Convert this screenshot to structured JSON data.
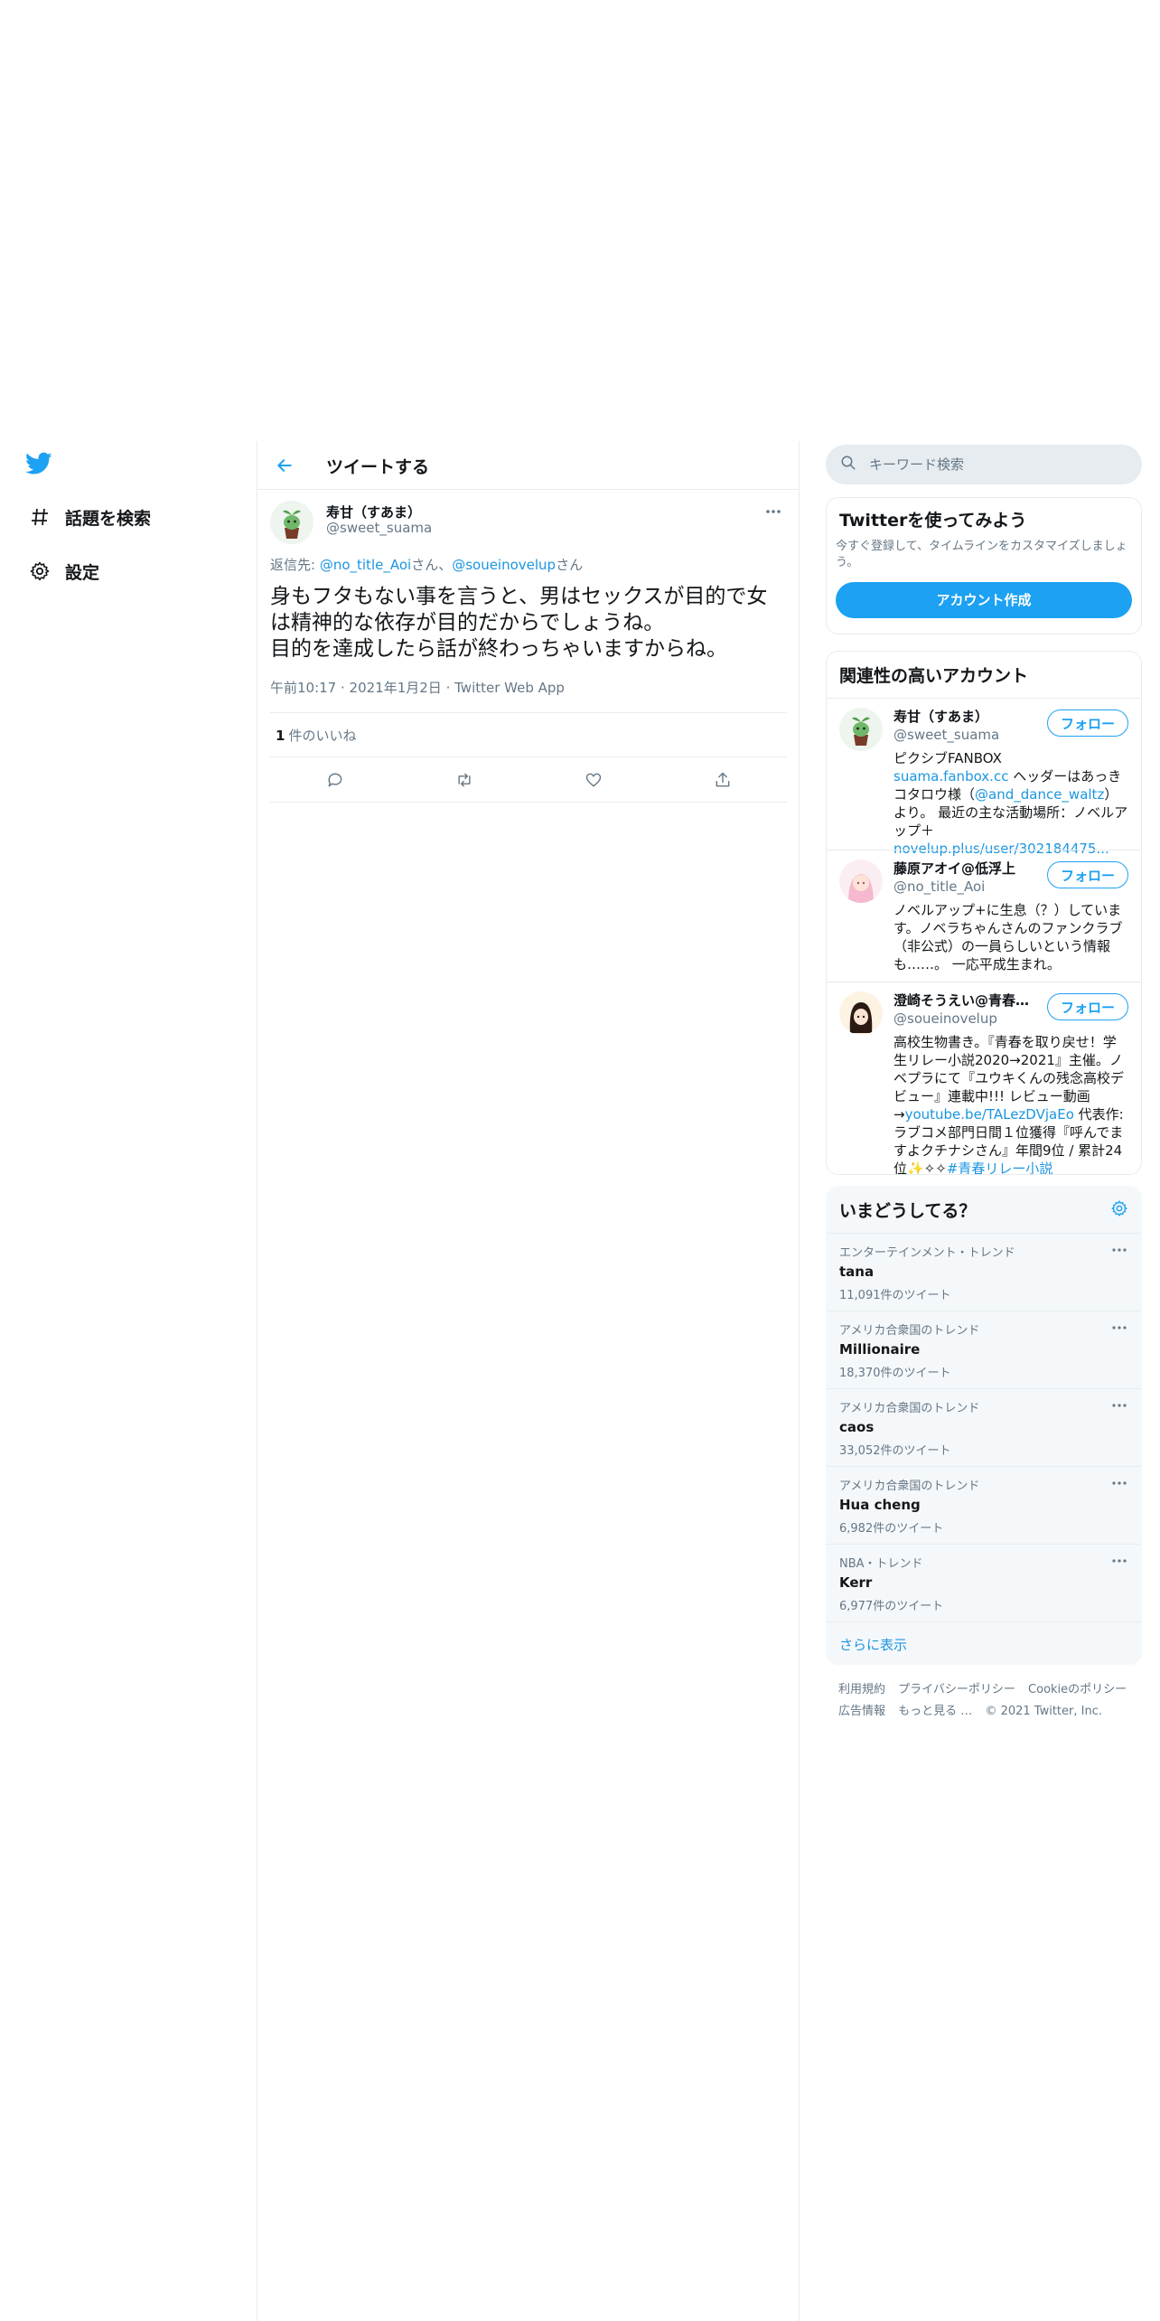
{
  "nav": {
    "logo_icon": "twitter-bird-icon",
    "items": [
      {
        "label": "話題を検索",
        "icon": "hashtag-icon"
      },
      {
        "label": "設定",
        "icon": "gear-icon"
      }
    ]
  },
  "header": {
    "title": "ツイートする"
  },
  "tweet": {
    "name": "寿甘（すあま）",
    "handle": "@sweet_suama",
    "reply_prefix": "返信先: ",
    "reply_user1": "@no_title_Aoi",
    "reply_sep": "さん、",
    "reply_user2": "@soueinovelup",
    "reply_suffix": "さん",
    "text": "身もフタもない事を言うと、男はセックスが目的で女は精神的な依存が目的だからでしょうね。\n目的を達成したら話が終わっちゃいますからね。",
    "time": "午前10:17",
    "date": "2021年1月2日",
    "source": "Twitter Web App",
    "likes_count": "1",
    "likes_label": "件のいいね"
  },
  "search": {
    "placeholder": "キーワード検索"
  },
  "signup": {
    "title": "Twitterを使ってみよう",
    "desc": "今すぐ登録して、タイムラインをカスタマイズしましょう。",
    "button": "アカウント作成"
  },
  "accounts": {
    "title": "関連性の高いアカウント",
    "follow_label": "フォロー",
    "items": [
      {
        "name": "寿甘（すあま）",
        "handle": "@sweet_suama",
        "bio_1": "ピクシブFANBOX　",
        "link_1": "suama.fanbox.cc",
        "bio_2": " ヘッダーはあっきコタロウ様（",
        "link_2": "@and_dance_waltz",
        "bio_3": "）より。 最近の主な活動場所：ノベルアップ＋　",
        "link_3": "novelup.plus/user/302184475..."
      },
      {
        "name": "藤原アオイ@低浮上",
        "handle": "@no_title_Aoi",
        "bio": "ノベルアップ+に生息（？）しています。ノベラちゃんさんのファンクラブ（非公式）の一員らしいという情報も……。 一応平成生まれ。"
      },
      {
        "name": "澄崎そうえい@青春…",
        "handle": "@soueinovelup",
        "bio_1": "高校生物書き。『青春を取り戻せ！学生リレー小説2020→2021』主催。ノベプラにて『ユウキくんの残念高校デビュー』連載中!!! レビュー動画→",
        "link_1": "youtube.be/TALezDVjaEo",
        "bio_2": " 代表作:ラブコメ部門日間１位獲得『呼んでますよクチナシさん』年間9位 / 累計24位✨✧✧",
        "link_2": "#青春リレー小説"
      }
    ]
  },
  "trends": {
    "title": "いまどうしてる？",
    "items": [
      {
        "context": "エンターテインメント・トレンド",
        "name": "tana",
        "count": "11,091件のツイート"
      },
      {
        "context": "アメリカ合衆国のトレンド",
        "name": "Millionaire",
        "count": "18,370件のツイート"
      },
      {
        "context": "アメリカ合衆国のトレンド",
        "name": "caos",
        "count": "33,052件のツイート"
      },
      {
        "context": "アメリカ合衆国のトレンド",
        "name": "Hua cheng",
        "count": "6,982件のツイート"
      },
      {
        "context": "NBA・トレンド",
        "name": "Kerr",
        "count": "6,977件のツイート"
      }
    ],
    "show_more": "さらに表示"
  },
  "footer": {
    "links": [
      "利用規約",
      "プライバシーポリシー",
      "Cookieのポリシー",
      "広告情報",
      "もっと見る …"
    ],
    "copyright": "© 2021 Twitter, Inc."
  },
  "colors": {
    "accent": "#1da1f2",
    "link": "#1b95e0",
    "secondary_text": "#657786",
    "border": "#e6ecf0"
  }
}
